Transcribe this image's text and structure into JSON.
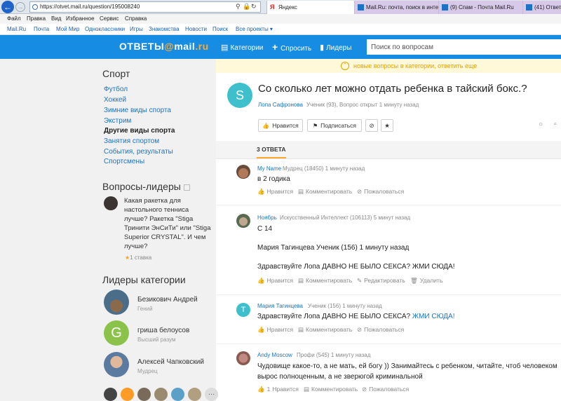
{
  "browser": {
    "back_icon": "arrow-left-icon",
    "url": "https://otvet.mail.ru/question/195008240",
    "tabs": [
      {
        "label": "Яндекс",
        "color": "#e02020",
        "favicon": "Я"
      },
      {
        "label": "Mail.Ru: почта, поиск в интер...",
        "color": "#1a73c6"
      },
      {
        "label": "(9) Спам - Почта Mail.Ru",
        "color": "#1a73c6"
      },
      {
        "label": "(41) Ответ",
        "color": "#1a73c6"
      }
    ],
    "menu": [
      "Файл",
      "Правка",
      "Вид",
      "Избранное",
      "Сервис",
      "Справка"
    ],
    "bookmarks": [
      "Mail.Ru",
      "Почта",
      "Мой Мир",
      "Одноклассники",
      "Игры",
      "Знакомства",
      "Новости",
      "Поиск",
      "Все проекты ▾"
    ]
  },
  "header": {
    "logo_part1": "ОТВЕТЫ",
    "logo_at": "@",
    "logo_part2": "mail",
    "logo_dot": ".ru",
    "nav": [
      "Категории",
      "Спросить",
      "Лидеры"
    ],
    "search_placeholder": "Поиск по вопросам",
    "bg_color": "#168de2"
  },
  "sidebar": {
    "category_title": "Спорт",
    "links": [
      "Футбол",
      "Хоккей",
      "Зимние виды спорта",
      "Экстрим",
      "Другие виды спорта",
      "Занятия спортом",
      "События, результаты",
      "Спортсмены"
    ],
    "current_link": "Другие виды спорта",
    "leader_questions_title": "Вопросы-лидеры",
    "leader_question": "Какая ракетка для настольного тенниса лучше? Ракетка \"Stiga Тринити ЭнСиТи\" или \"Stiga Superior CRYSTAL\". И чем лучше?",
    "leader_question_star": "★",
    "leader_question_bets": "1 ставка",
    "leaders_title": "Лидеры категории",
    "leaders": [
      {
        "name": "Безикович Андрей",
        "rank": "Гений"
      },
      {
        "name": "гриша белоусов",
        "rank": "Высший разум",
        "initial": "G"
      },
      {
        "name": "Алексей Чапковский",
        "rank": "Мудрец"
      }
    ],
    "more_label": "…"
  },
  "banner": {
    "text": "новые вопросы в категории, ответить еще"
  },
  "question": {
    "avatar_letter": "S",
    "title": "Со сколько лет можно отдать ребенка в тайский бокс.?",
    "author": "Лопа Сафронова",
    "meta": "Ученик (93), Вопрос открыт 1 минуту назад",
    "buttons": {
      "like": "Нравится",
      "subscribe": "Подписаться",
      "block": "⊘",
      "star": "★"
    }
  },
  "answers": {
    "count_label": "3 ОТВЕТА",
    "items": [
      {
        "author": "My Name",
        "meta": "Мудрец (18450) 1 минуту назад",
        "text": "в 2 годика"
      },
      {
        "author": "Ноябрь",
        "meta": "Искусственный Интеллект (106113) 5 минут назад",
        "lines": [
          "С 14",
          "Мария Тагинцева Ученик (156) 1 минуту назад",
          "Здравствуйте Лопа ДАВНО НЕ БЫЛО СЕКСА? ЖМИ СЮДА!"
        ]
      },
      {
        "author": "Мария Тагинцева",
        "meta": "Ученик (156) 1 минуту назад",
        "text": "Здравствуйте Лопа ДАВНО НЕ БЫЛО СЕКСА? ",
        "link": "ЖМИ СЮДА!"
      },
      {
        "author": "Andy Moscow",
        "meta": "Профи (545) 1 минуту назад",
        "lines": [
          "Чудовище какое-то, а не мать, ей богу )) Занимайтесь с ребенком, читайте, чтоб человеком",
          "вырос полноценным, а не зверюгой криминальной"
        ]
      }
    ],
    "actions": {
      "like": "Нравится",
      "comment": "Комментировать",
      "complain": "Пожаловаться",
      "edit": "Редактировать",
      "delete": "Удалить",
      "like_count": "1"
    }
  }
}
